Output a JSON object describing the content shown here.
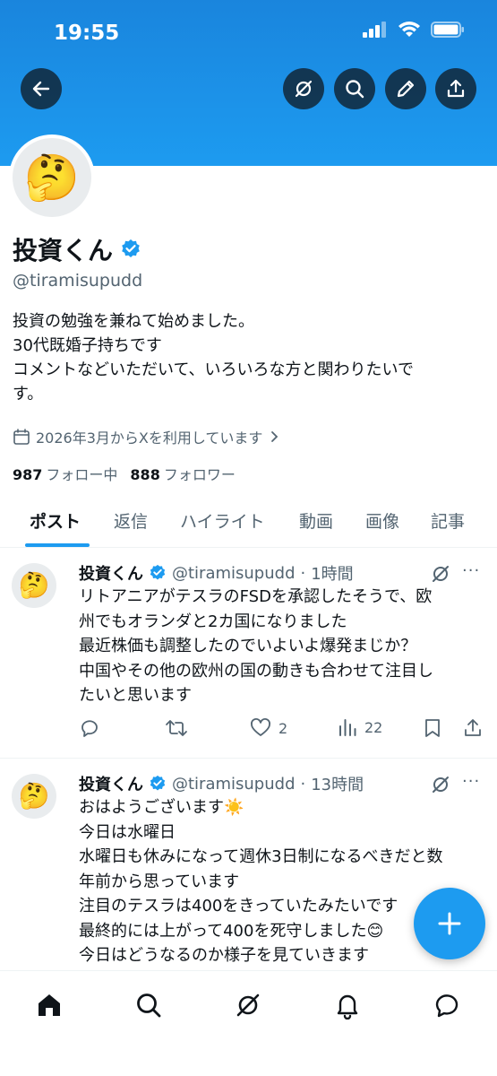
{
  "status_bar": {
    "time": "19:55"
  },
  "profile": {
    "name": "投資くん",
    "handle": "@tiramisupudd",
    "bio": [
      "投資の勉強を兼ねて始めました。",
      "30代既婚子持ちです",
      "コメントなどいただいて、いろいろな方と関わりたいで",
      "す。"
    ],
    "joined": "2026年3月からXを利用しています",
    "following_count": "987",
    "following_label": "フォロー中",
    "followers_count": "888",
    "followers_label": "フォロワー",
    "avatar_emoji": "🤔"
  },
  "tabs": [
    "ポスト",
    "返信",
    "ハイライト",
    "動画",
    "画像",
    "記事"
  ],
  "active_tab": "ポスト",
  "posts": [
    {
      "name": "投資くん",
      "handle": "@tiramisupudd",
      "time": "1時間",
      "lines": [
        "リトアニアがテスラのFSDを承認したそうで、欧",
        "州でもオランダと2カ国になりました",
        "最近株価も調整したのでいよいよ爆発まじか？",
        "中国やその他の欧州の国の動きも合わせて注目し",
        "たいと思います"
      ],
      "likes": "2",
      "views": "22"
    },
    {
      "name": "投資くん",
      "handle": "@tiramisupudd",
      "time": "13時間",
      "lines": [
        "おはようございます☀️",
        "今日は水曜日",
        "水曜日も休みになって週休3日制になるべきだと数",
        "年前から思っています",
        "注目のテスラは400をきっていたみたいです",
        "最終的には上がって400を死守しました😊",
        "今日はどうなるのか様子を見ていきます"
      ]
    }
  ],
  "more_label": "···",
  "colors": {
    "accent": "#1d9bf0",
    "text": "#0f1419",
    "secondary": "#536471"
  }
}
